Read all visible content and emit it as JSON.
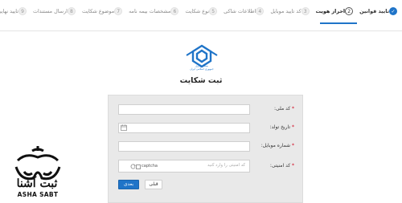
{
  "stepper": {
    "steps": [
      {
        "num": "✓",
        "label": "تایید قوانین",
        "state": "done"
      },
      {
        "num": "2",
        "label": "احراز هویت",
        "state": "active"
      },
      {
        "num": "3",
        "label": "کد تایید موبایل",
        "state": "pending"
      },
      {
        "num": "4",
        "label": "اطلاعات شاکی",
        "state": "pending"
      },
      {
        "num": "5",
        "label": "نوع شکایت",
        "state": "pending"
      },
      {
        "num": "6",
        "label": "مشخصات بیمه نامه",
        "state": "pending"
      },
      {
        "num": "7",
        "label": "موضوع شکایت",
        "state": "pending"
      },
      {
        "num": "8",
        "label": "ارسال مستندات",
        "state": "pending"
      },
      {
        "num": "9",
        "label": "تایید نهایی",
        "state": "pending"
      }
    ]
  },
  "header": {
    "logo_text_line1": "بیمه مرکزی",
    "logo_text_line2": "جمهوری اسلامی ایران",
    "page_title": "ثبت شکایت"
  },
  "form": {
    "national_code": {
      "label": "کد ملی:",
      "required": "*",
      "value": ""
    },
    "birth_date": {
      "label": "تاریخ تولد:",
      "required": "*",
      "value": ""
    },
    "mobile": {
      "label": "شماره موبایل:",
      "required": "*",
      "value": ""
    },
    "captcha": {
      "label": "کد امنیتی:",
      "required": "*",
      "image_alt": "captcha",
      "placeholder": "کد امنیتی را وارد کنید"
    },
    "next_label": "بعدی",
    "prev_label": "قبلی"
  },
  "brand": {
    "name_fa": "ثبت آشنا",
    "name_en": "ASHA SABT"
  },
  "colors": {
    "accent": "#1f74c8",
    "required": "#d0021b",
    "panel_bg": "#e9e9e9"
  }
}
